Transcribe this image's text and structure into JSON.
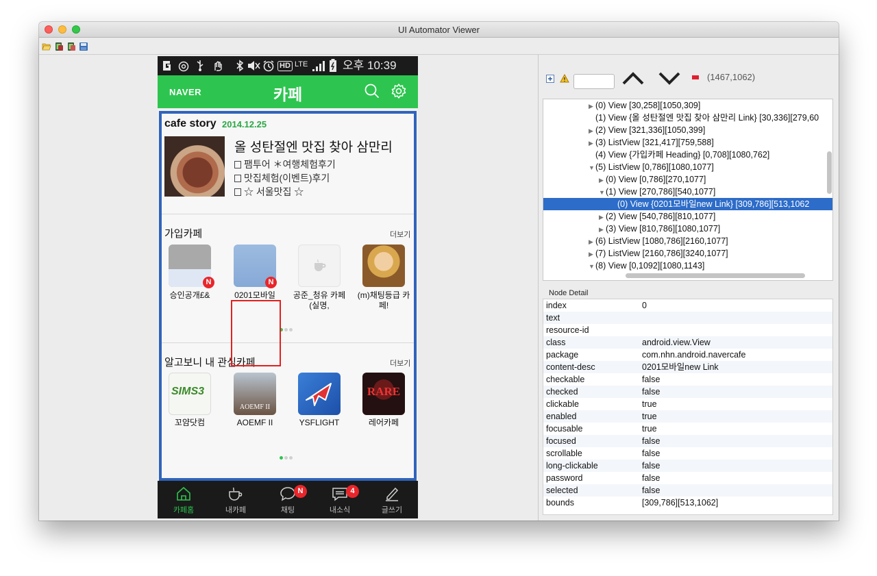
{
  "window": {
    "title": "UI Automator Viewer"
  },
  "phone": {
    "status_bar": {
      "icons": [
        "samsung-g-icon",
        "circle-at-icon",
        "usb-icon",
        "hand-icon",
        "bluetooth-icon",
        "mute-icon",
        "alarm-icon",
        "hd-icon",
        "lte-icon",
        "signal-icon",
        "battery-icon"
      ],
      "hd": "HD",
      "lte": "LTE",
      "time": "오후 10:39"
    },
    "app_bar": {
      "brand": "NAVER",
      "title": "카페"
    },
    "story": {
      "title": "cafe story",
      "date": "2014.12.25",
      "headline": "올 성탄절엔 맛집 찾아 삼만리",
      "lines": [
        "팸투어 ＊여행체험후기",
        "맛집체험(이벤트)후기",
        "☆ 서울맛집 ☆"
      ]
    },
    "joined_cafes": {
      "title": "가입카페",
      "more": "더보기",
      "items": [
        {
          "name": "승인공개£&",
          "badge": "N"
        },
        {
          "name": "0201모바일",
          "badge": "N"
        },
        {
          "name": "공준_청유 카페(실명,",
          "badge": ""
        },
        {
          "name": "(m)채팅등급 카페!",
          "badge": ""
        }
      ]
    },
    "interest_cafes": {
      "title": "알고보니 내 관심카페",
      "more": "더보기",
      "items": [
        {
          "name": "꼬얌닷컴",
          "logo_text": "SIMS3"
        },
        {
          "name": "AOEMF II",
          "logo_text": "AOEMF II"
        },
        {
          "name": "YSFLIGHT",
          "logo_text": ""
        },
        {
          "name": "레어카페",
          "logo_text": "RARE"
        }
      ]
    },
    "tabs": [
      {
        "label": "카페홈",
        "icon": "home-icon",
        "badge": "",
        "active": true
      },
      {
        "label": "내카페",
        "icon": "cup-icon",
        "badge": "",
        "active": false
      },
      {
        "label": "채팅",
        "icon": "chat-icon",
        "badge": "N",
        "active": false
      },
      {
        "label": "내소식",
        "icon": "news-icon",
        "badge": "4",
        "active": false
      },
      {
        "label": "글쓰기",
        "icon": "pen-icon",
        "badge": "",
        "active": false
      }
    ]
  },
  "tree_toolbar": {
    "coords": "(1467,1062)"
  },
  "tree": [
    {
      "arrow": "▶",
      "text": "(0) View [30,258][1050,309]",
      "selected": false
    },
    {
      "arrow": "",
      "text": "(1) View {올 성탄절엔 맛집 찾아 삼만리 Link} [30,336][279,60",
      "selected": false
    },
    {
      "arrow": "▶",
      "text": "(2) View [321,336][1050,399]",
      "selected": false
    },
    {
      "arrow": "▶",
      "text": "(3) ListView [321,417][759,588]",
      "selected": false
    },
    {
      "arrow": "",
      "text": "(4) View {가입카페 Heading} [0,708][1080,762]",
      "selected": false
    },
    {
      "arrow": "▼",
      "text": "(5) ListView [0,786][1080,1077]",
      "selected": false
    },
    {
      "arrow": "▶",
      "text": "(0) View [0,786][270,1077]",
      "selected": false
    },
    {
      "arrow": "▼",
      "text": "(1) View [270,786][540,1077]",
      "selected": false
    },
    {
      "arrow": "",
      "text": "(0) View {0201모바일new Link} [309,786][513,1062",
      "selected": true
    },
    {
      "arrow": "▶",
      "text": "(2) View [540,786][810,1077]",
      "selected": false
    },
    {
      "arrow": "▶",
      "text": "(3) View [810,786][1080,1077]",
      "selected": false
    },
    {
      "arrow": "▶",
      "text": "(6) ListView [1080,786][2160,1077]",
      "selected": false
    },
    {
      "arrow": "▶",
      "text": "(7) ListView [2160,786][3240,1077]",
      "selected": false
    },
    {
      "arrow": "▼",
      "text": "(8) View [0,1092][1080,1143]",
      "selected": false
    }
  ],
  "node_detail": {
    "title": "Node Detail",
    "rows": [
      {
        "key": "index",
        "value": "0"
      },
      {
        "key": "text",
        "value": ""
      },
      {
        "key": "resource-id",
        "value": ""
      },
      {
        "key": "class",
        "value": "android.view.View"
      },
      {
        "key": "package",
        "value": "com.nhn.android.navercafe"
      },
      {
        "key": "content-desc",
        "value": "0201모바일new Link"
      },
      {
        "key": "checkable",
        "value": "false"
      },
      {
        "key": "checked",
        "value": "false"
      },
      {
        "key": "clickable",
        "value": "true"
      },
      {
        "key": "enabled",
        "value": "true"
      },
      {
        "key": "focusable",
        "value": "true"
      },
      {
        "key": "focused",
        "value": "false"
      },
      {
        "key": "scrollable",
        "value": "false"
      },
      {
        "key": "long-clickable",
        "value": "false"
      },
      {
        "key": "password",
        "value": "false"
      },
      {
        "key": "selected",
        "value": "false"
      },
      {
        "key": "bounds",
        "value": "[309,786][513,1062]"
      }
    ]
  },
  "colors": {
    "naver_green": "#2dc54f",
    "selection_blue": "#2d6cc8",
    "badge_red": "#e8262b"
  }
}
